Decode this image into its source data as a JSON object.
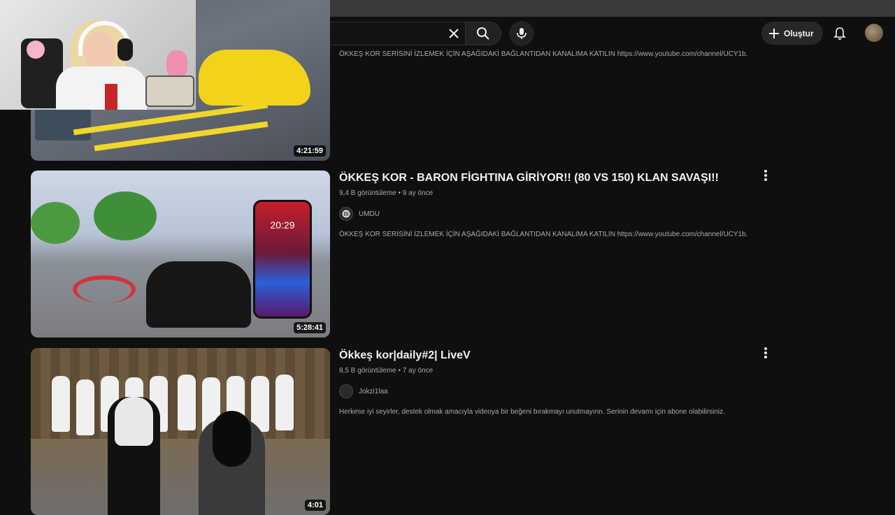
{
  "header": {
    "create_label": "Oluştur"
  },
  "videos": [
    {
      "title": "",
      "description": "ÖKKEŞ KOR SERİSİNİ İZLEMEK İÇİN AŞAĞIDAKİ BAĞLANTIDAN KANALIMA KATILIN https://www.youtube.com/channel/UCY1b.",
      "duration": "4:21:59"
    },
    {
      "title": "ÖKKEŞ KOR - BARON FİGHTINA GİRİYOR!! (80 VS 150) KLAN SAVAŞI!!",
      "views": "9,4 B görüntüleme",
      "age": "9 ay önce",
      "channel": "UMDU",
      "description": "ÖKKEŞ KOR SERİSİNİ İZLEMEK İÇİN AŞAĞIDAKİ BAĞLANTIDAN KANALIMA KATILIN https://www.youtube.com/channel/UCY1b.",
      "duration": "5:28:41",
      "phone_time": "20:29"
    },
    {
      "title": "Ökkeş kor|daily#2| LiveV",
      "views": "8,5 B görüntüleme",
      "age": "7 ay önce",
      "channel": "Jokzi1laa",
      "description": "Herkese iyi seyirler, destek olmak amacıyla videoya bir beğeni bırakmayı unutmayınn. Serinin devamı için abone olabilirsiniz.",
      "duration": "4:01"
    }
  ],
  "meta_separator": "•",
  "colors": {
    "background": "#0f0f0f",
    "text_primary": "#f1f1f1",
    "text_secondary": "#aaaaaa"
  }
}
